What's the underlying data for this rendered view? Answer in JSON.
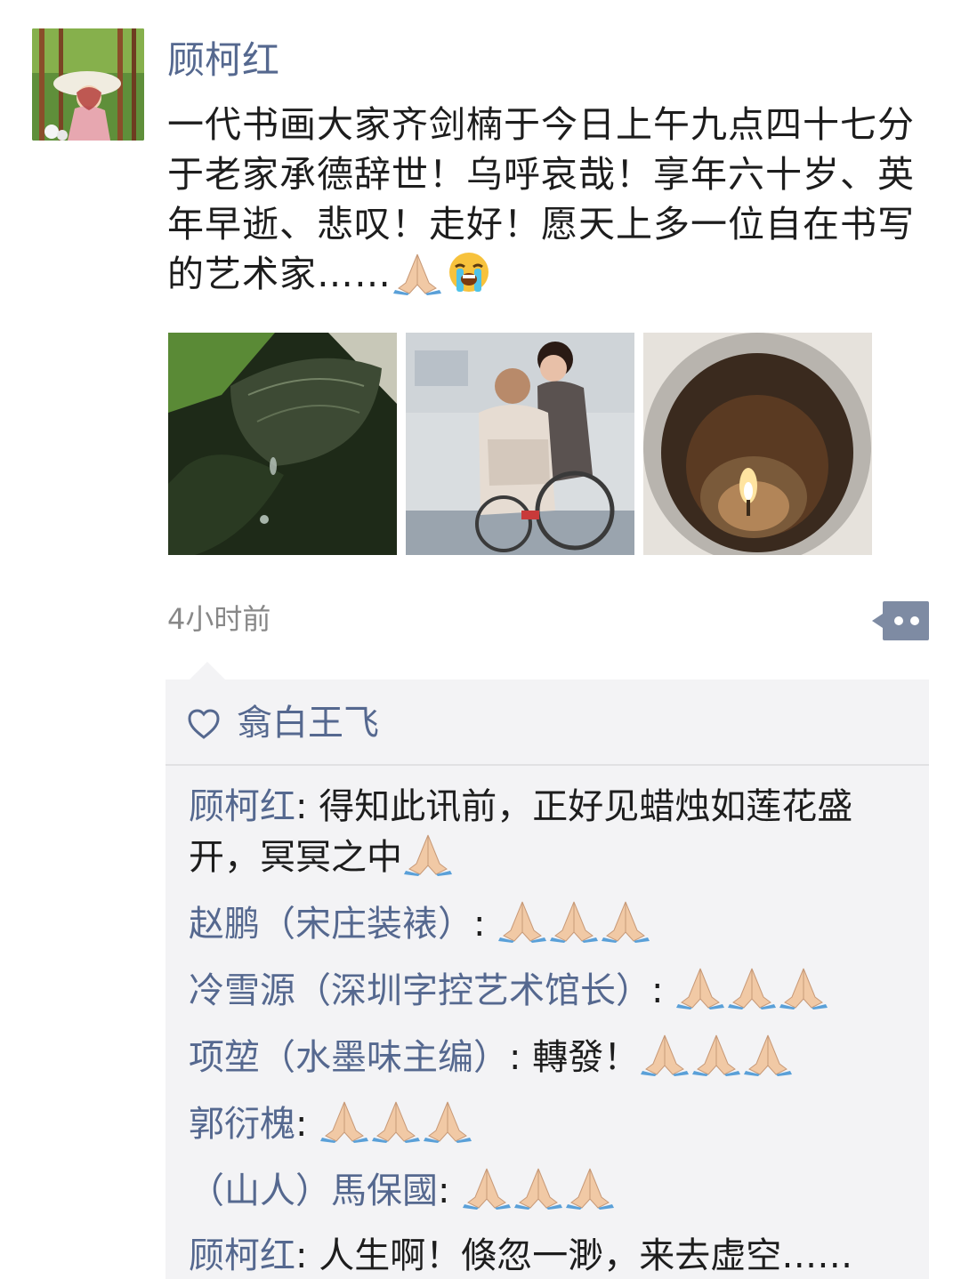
{
  "post": {
    "author": "顾柯红",
    "text": "一代书画大家齐剑楠于今日上午九点四十七分于老家承德辞世！乌呼哀哉！享年六十岁、英年早逝、悲叹！走好！愿天上多一位自在书写的艺术家……",
    "text_emojis": [
      "folded-hands-emoji",
      "loudly-crying-face-emoji"
    ],
    "photos": [
      {
        "name": "photo-leaf-raindrop"
      },
      {
        "name": "photo-couple-wheelchair"
      },
      {
        "name": "photo-candle-flame"
      }
    ],
    "timestamp": "4小时前",
    "more_icon": "comment-more-icon"
  },
  "likes": {
    "icon": "heart-icon",
    "names": "翕白王飞"
  },
  "comments": [
    {
      "author": "顾柯红",
      "separator": ": ",
      "text": "得知此讯前，正好见蜡烛如莲花盛开，冥冥之中",
      "emoji_count": 1
    },
    {
      "author": "赵鹏（宋庄装裱）",
      "separator": ": ",
      "text": "",
      "emoji_count": 3
    },
    {
      "author": "冷雪源（深圳字控艺术馆长）",
      "separator": ": ",
      "text": "",
      "emoji_count": 3
    },
    {
      "author": "项堃（水墨味主编）",
      "separator": ": ",
      "text": "轉發！",
      "emoji_count": 3
    },
    {
      "author": "郭衍槐",
      "separator": ": ",
      "text": "",
      "emoji_count": 3
    },
    {
      "author": "（山人）馬保國",
      "separator": ": ",
      "text": "",
      "emoji_count": 3
    },
    {
      "author": "顾柯红",
      "separator": ": ",
      "text": "人生啊！倏忽一渺，来去虚空……",
      "emoji_count": 0
    }
  ],
  "colors": {
    "link_blue": "#55688f",
    "text": "#1d1d1d",
    "comment_bg": "#f3f3f5",
    "timestamp_gray": "#888888"
  }
}
